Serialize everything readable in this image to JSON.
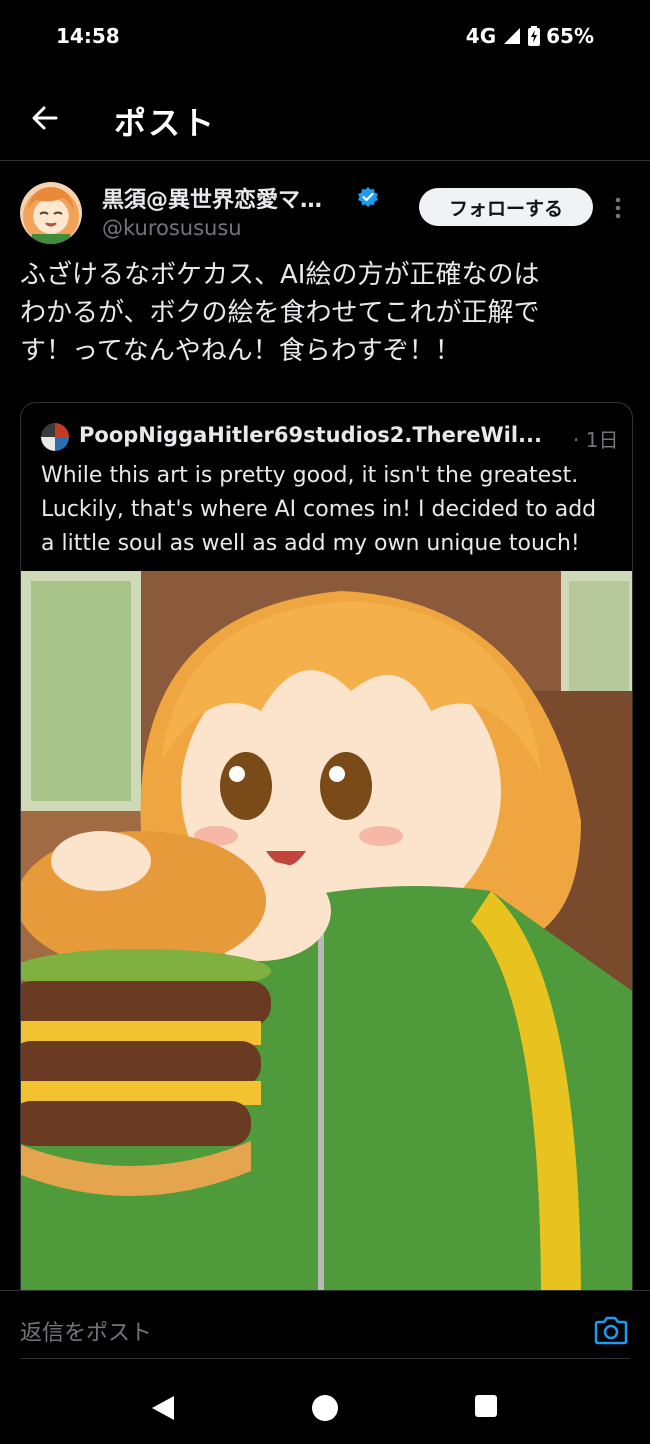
{
  "status_bar": {
    "time": "14:58",
    "network": "4G",
    "battery": "65%"
  },
  "header": {
    "title": "ポスト"
  },
  "tweet": {
    "display_name": "黒須@異世界恋愛マ…",
    "handle": "@kurosususu",
    "follow_label": "フォローする",
    "text_lines": [
      "ふざけるなボケカス、AI絵の方が正確なのは",
      "わかるが、ボクの絵を食わせてこれが正解で",
      "す！ってなんやねん！食らわすぞ！！"
    ]
  },
  "quote": {
    "name": "PoopNiggaHitler69studios2.ThereWil...",
    "time": "· 1日",
    "text_lines": [
      "While this art is pretty good, it isn't the greatest.",
      "Luckily, that's where AI comes in! I decided to add",
      "a little soul as well as add my own unique touch!"
    ]
  },
  "reply_bar": {
    "placeholder": "返信をポスト"
  },
  "colors": {
    "accent": "#1d9bf0",
    "background": "#000000",
    "text": "#e7e9ea",
    "muted": "#71767b",
    "border": "#2f3336"
  },
  "icons": [
    "signal-icon",
    "battery-icon",
    "back-arrow-icon",
    "verified-badge-icon",
    "more-icon",
    "camera-icon",
    "nav-back-icon",
    "nav-home-icon",
    "nav-recents-icon"
  ]
}
